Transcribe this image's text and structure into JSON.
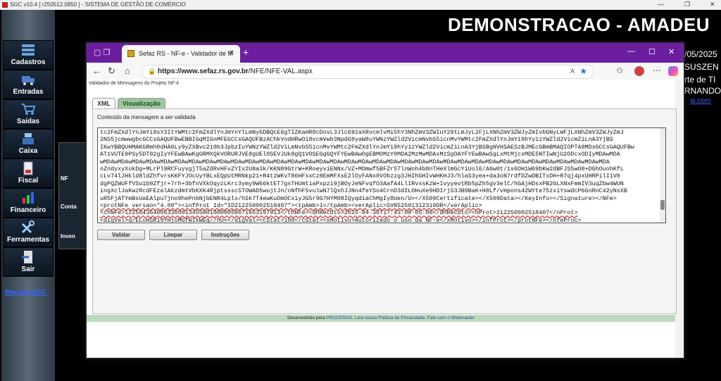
{
  "app": {
    "window_title": "SGC v10.4 [ r250512.0850 ] - SISTEMA DE GESTÃO DE COMÉRCIO",
    "banner": "DEMONSTRACAO - AMADEU",
    "info_date": "/05/2025",
    "info_line2": "SUSZEN",
    "info_line3": "rte de TI",
    "info_line4": "RNANDO",
    "info_link": "ai.com"
  },
  "sidebar": {
    "items": [
      {
        "label": "Cadastros",
        "icon": "cadastros-icon"
      },
      {
        "label": "Entradas",
        "icon": "truck-icon"
      },
      {
        "label": "Saídas",
        "icon": "cart-icon"
      },
      {
        "label": "Caixa",
        "icon": "cash-register-icon"
      },
      {
        "label": "Fiscal",
        "icon": "document-icon"
      },
      {
        "label": "Financeiro",
        "icon": "chart-icon"
      },
      {
        "label": "Ferramentas",
        "icon": "tools-icon"
      },
      {
        "label": "Sair",
        "icon": "exit-icon"
      }
    ],
    "manual_link": "Manual SGC"
  },
  "submenu": {
    "items": [
      {
        "label": "NF"
      },
      {
        "label": "Conta"
      },
      {
        "label": "Inven"
      }
    ]
  },
  "browser": {
    "tab_title": "Sefaz RS - NF-e - Validador de M",
    "url_domain": "https://www.sefaz.rs.gov.br",
    "url_path": "/NFE/NFE-VAL.aspx"
  },
  "page": {
    "header": "Validador de Mensagens do Projeto NF-e",
    "tabs": [
      "XML",
      "Visualização"
    ],
    "content_label": "Conteúdo da mensagem a ser validada",
    "xml_lines": [
      "tc2FmZXdlYnJmYi9sY3ItYWMtc2FmZXdlYnJmYnYlLmNybDBQcE6gTIZKaHR0cDovL3Jlc69zaXRvcmlvMi5hY3NhZmV3ZWIuY29tLmJyL2FjLXNhZmV3ZWJyZmIvbGNyLWFjLXNhZmV3ZWJyZmJ",
      "2NS5jcmwwgbcGCCsGAQUFBwEBBIGqMIGnMFEGCCsGAQUFBzAChkVodHRwOi8vcmVwb3NpdG9yaW8uYWNzYWZld2VicmNvbS5icnMvYWMtc2FmZXdlYnJmYi9hYy1zYWZld2VicmZiLnA3YjBS",
      "IKwYBBQUHMAKGRmh0dHA6Ly9yZXBvc210b3JpbzIuYWNzYWZld2ViLmNvbS5icnMvYWMtc2FmZXdlYnJmYi9hYy1zYWZld2VicmZiLnA3YjBSBgNVHSAESzBJMEcGBmBMAQIOPTA9MDsGCCsGAQUFBw",
      "AT1VUTE9PSy5DT02gIyYFEwBAwKgGRMXQkVORURJVE8gUEl0SEVJUk8gQ1VOSEGgGQYFYEwBAwOgEBMOMzY0MDA2MzMwMDAxMzSgOAYFYEwBAwSgLxMtMjcxMDE5NTIwNjU2ODcxODIyMDAwMDA",
      "wMDAwMDAwMDAwMDAwMDAwMDAwMDAwMDAwMDAwMDAwMDAwMDAwMDAwMDAwMDAwMDAwMDAwMDAwMDAwMDAwMDAwMDAwMDAwMDAwMDAwMDAwMDAwMDAwMDAwMDAwMDAwMDAwMDAwMDAwMDAwMDA",
      "nZndyxyXokDg+MLrPl9RCFuyvgjT5aZdRvHFvZYIx2U8a3k/KKN89GtrW+KRoeyviENNx/VZ+MOmwf5BFZr57lnWoh4b8nTHeXlmGcYiUol6/A6w0t/1s6OH1W69bKw2dBFJS5wO8+DGhOuohKfL",
      "cLv74lJHkld8ldZhfvrsKKFYJOcUyYBLxEQpUtMRNkp21+R4tzWKvT86HFxxCz8EmMFXsE2lOyFANx0VObzzg3JHIhGHIvWHKHJ3/hlaS3yea+da3oN7rdfDZwDBITxDH+R7qj4pxUHRPilI1V0",
      "dgPQZWUFfVSu1b9Zfjr+7rh+3bfnVXkOqyzLKrc3ymy9W66ktET7gsTHUmtiaPxpzi9jBOyJeNFvqfO3AafA4LlIRvxsKzW+IvyyevtRb5pZh5gv3elC/hGAjHDsxPB2GLXNxFmmIV3uqZbw4WUN",
      "ingXclJaKwzRcdFEzalAkzdmtVbKXK4RjptssscSTOWAD5wujtJn/oNfhF5vulwN7lQxhJJNn4feYSo4CrnD3dILOHuXe9HDIrjS3JB9BaK+H8Lf/vHpons42WYte75zxiYswdcP6GoRnC42yNsXB",
      "uR5FjATYmBsUaEAlpu7jno9hePnbNjbENR4Lplx/hSk7T4ewKuOmOCxiyJG5r9G7HYM08IQyqdiaChMgIy8Uen/U=</X509Certificate></X509Data></KeyInfo></Signature></NFe>",
      "<protNFe versao=\"4.00\"><infProt Id=\"ID212250002518407\"><tpAmb>1</tpAmb><verAplic>SVRS2501312310DR</verAplic>",
      "<chNFe>12250436400633000134550010000058071653197913</chNFe><dhRecbto>2025-04-30T17:43:08-05:00</dhRecbto><nProt>212250002518407</nProt>",
      "<digVal>q/ELoHSR19YHjoMGfWIkWEq//hU=</digVal><cStat>100</cStat><xMotivo>Autorizado o uso da NF-e</xMotivo></infProt></protNFe></nfeProc>"
    ],
    "buttons": [
      "Validar",
      "Limpar",
      "Instruções"
    ],
    "footer_prefix": "Desenvolvido pela",
    "footer_procergs": "PROCERGS",
    "footer_privacy": "Leia nossa Política de Privacidade",
    "footer_webmaster": "Fale com o Webmaster"
  }
}
